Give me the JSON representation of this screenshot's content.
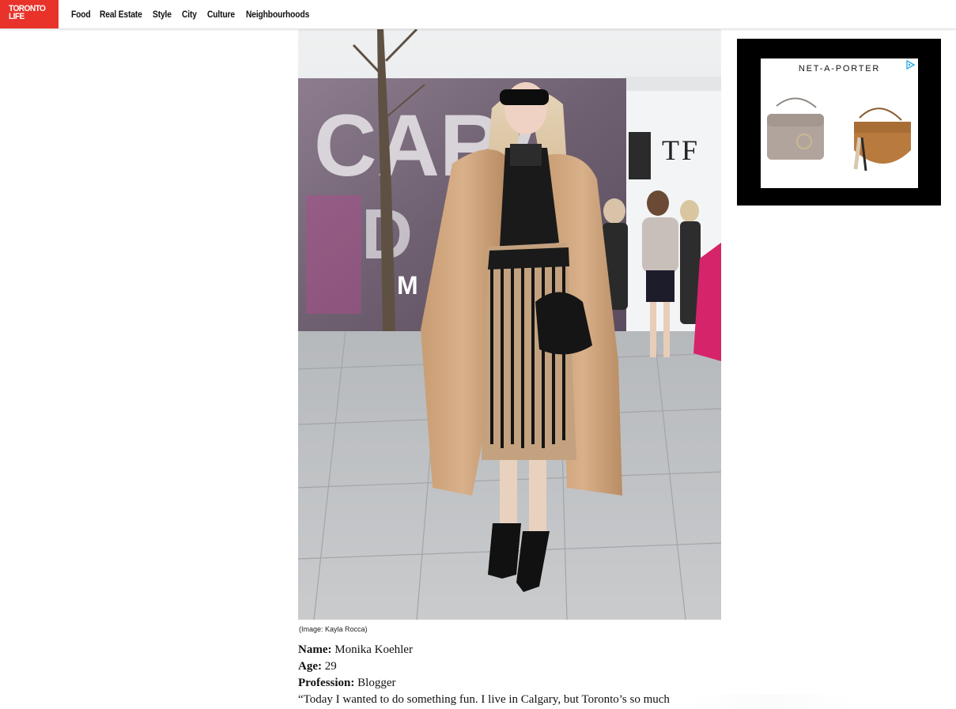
{
  "header": {
    "logo": {
      "line1": "TORONTO",
      "line2": "LIFE"
    },
    "nav": [
      "Food",
      "Real Estate",
      "Style",
      "City",
      "Culture",
      "Neighbourhoods"
    ]
  },
  "colors": {
    "brand_red": "#e8322a",
    "ad_background": "#000000"
  },
  "photo": {
    "alt": "Street style photo of a woman in a camel coat and fringe skirt",
    "caption": "(Image: Kayla Rocca)"
  },
  "article": {
    "name_label": "Name:",
    "name_value": "Monika Koehler",
    "age_label": "Age:",
    "age_value": "29",
    "profession_label": "Profession:",
    "profession_value": "Blogger",
    "quote_start": "“Today I wanted to do something fun. I live in Calgary, but Toronto’s so much"
  },
  "ad": {
    "brand": "NET-A-PORTER",
    "choices_icon": "adchoices-icon"
  }
}
